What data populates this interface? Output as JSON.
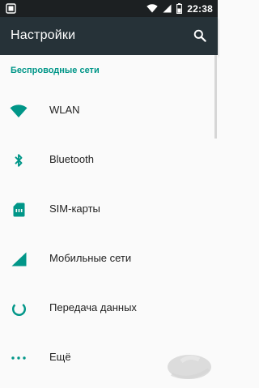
{
  "status_bar": {
    "time": "22:38",
    "background": "#1c2022"
  },
  "app_bar": {
    "title": "Настройки",
    "background": "#263238",
    "search_icon": "search-icon"
  },
  "section": {
    "header": "Беспроводные сети",
    "accent_color": "#009688"
  },
  "items": [
    {
      "label": "WLAN",
      "icon": "wifi-icon"
    },
    {
      "label": "Bluetooth",
      "icon": "bluetooth-icon"
    },
    {
      "label": "SIM-карты",
      "icon": "sim-card-icon"
    },
    {
      "label": "Мобильные сети",
      "icon": "signal-icon"
    },
    {
      "label": "Передача данных",
      "icon": "data-usage-icon"
    },
    {
      "label": "Ещё",
      "icon": "more-icon"
    }
  ]
}
